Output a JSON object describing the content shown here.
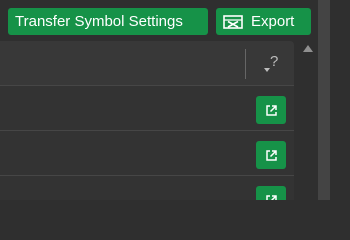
{
  "toolbar": {
    "transfer_label": "Transfer Symbol Settings",
    "export_label": "Export"
  },
  "table": {
    "help_glyph": "?",
    "rows": [
      {},
      {},
      {}
    ]
  },
  "icons": {
    "export": "spreadsheet-icon",
    "row_action": "external-link-icon",
    "help": "question-mark-icon",
    "scroll_up": "triangle-up-icon"
  },
  "colors": {
    "accent": "#169248",
    "background": "#2f2f2f",
    "panel": "#333333"
  }
}
